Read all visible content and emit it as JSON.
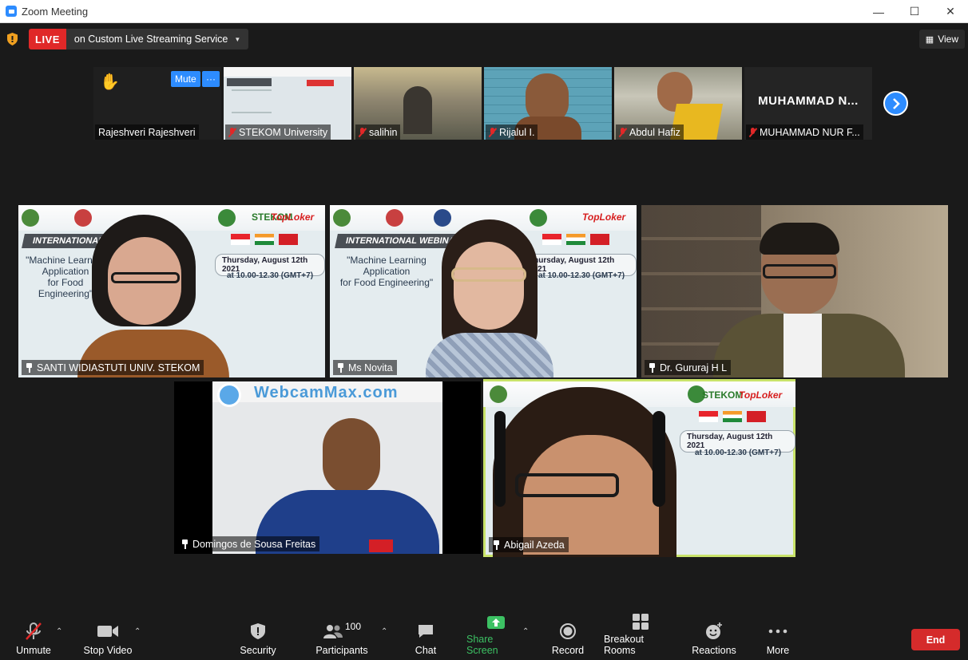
{
  "window": {
    "title": "Zoom Meeting"
  },
  "live": {
    "badge": "LIVE",
    "service": "on Custom Live Streaming Service"
  },
  "view_button": {
    "label": "View"
  },
  "thumbnails": [
    {
      "name": "Rajeshveri Rajeshveri",
      "muted": false,
      "mute_label": "Mute",
      "more_label": "···"
    },
    {
      "name": "STEKOM University",
      "muted": true
    },
    {
      "name": "salihin",
      "muted": true
    },
    {
      "name": "Rijalul I.",
      "muted": true
    },
    {
      "name": "Abdul Hafiz",
      "muted": true
    },
    {
      "name": "MUHAMMAD NUR F...",
      "muted": true,
      "display_name": "MUHAMMAD N..."
    }
  ],
  "slide": {
    "title_tag": "INTERNATIONAL WEBINAR",
    "line1": "\"Machine Learning",
    "line2": "Application",
    "line3": "for Food Engineering\"",
    "date": "Thursday, August 12th 2021",
    "time": "at 10.00-12.30 (GMT+7)",
    "brand_stekom": "STEKOM",
    "brand_toploker": "TopLoker",
    "webcammax": "WebcamMax.com"
  },
  "tiles": [
    {
      "name": "SANTI WIDIASTUTI UNIV. STEKOM"
    },
    {
      "name": "Ms Novita"
    },
    {
      "name": "Dr. Gururaj H L"
    },
    {
      "name": "Domingos de Sousa Freitas"
    },
    {
      "name": "Abigail Azeda"
    }
  ],
  "toolbar": {
    "unmute": "Unmute",
    "stop_video": "Stop Video",
    "security": "Security",
    "participants": "Participants",
    "participants_count": "100",
    "chat": "Chat",
    "share_screen": "Share Screen",
    "record": "Record",
    "breakout_rooms": "Breakout Rooms",
    "reactions": "Reactions",
    "more": "More",
    "end": "End"
  },
  "colors": {
    "accent": "#2d8cff",
    "live": "#e02828",
    "share": "#3cc163",
    "active_speaker": "#c9e36a",
    "end": "#d52b2b"
  }
}
